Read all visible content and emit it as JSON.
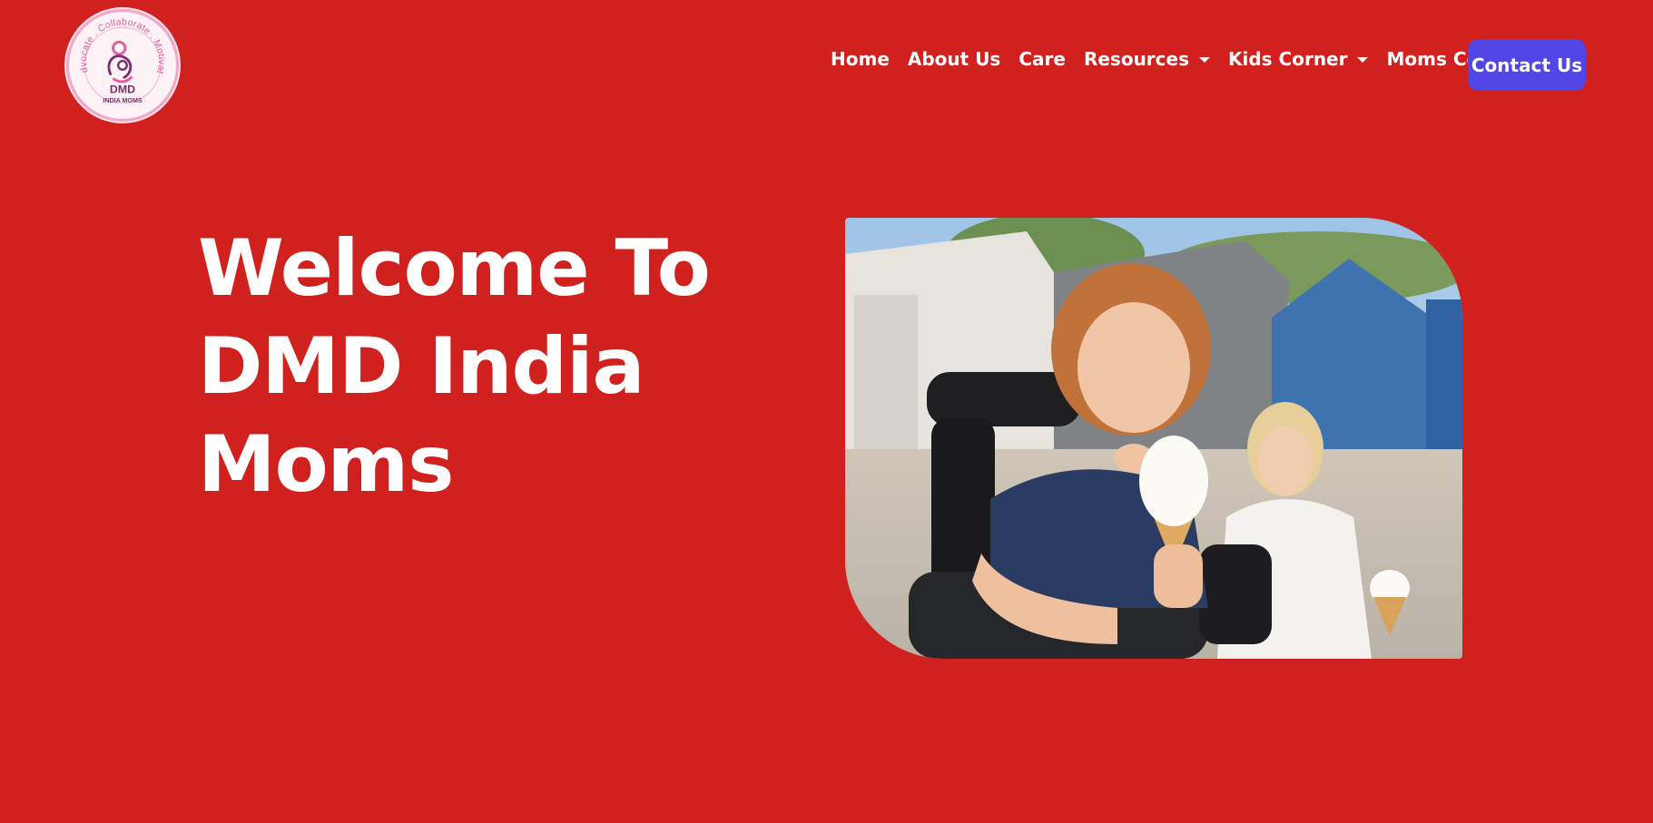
{
  "logo": {
    "arc_text": "Advocate . Collaborate . Motivate",
    "brand": "DMD",
    "sub": "INDIA MOMS"
  },
  "nav": {
    "items": [
      {
        "label": "Home",
        "dropdown": false
      },
      {
        "label": "About Us",
        "dropdown": false
      },
      {
        "label": "Care",
        "dropdown": false
      },
      {
        "label": "Resources",
        "dropdown": true
      },
      {
        "label": "Kids Corner",
        "dropdown": true
      },
      {
        "label": "Moms Corner",
        "dropdown": true
      }
    ],
    "contact_label": "Contact Us"
  },
  "hero": {
    "title_line1": "Welcome To",
    "title_line2": "DMD India",
    "title_line3": "Moms"
  },
  "colors": {
    "background": "#d0211f",
    "accent_button": "#5146e6",
    "text": "#ffffff",
    "logo_pink": "#e65c9a",
    "logo_purple": "#7a2f6e"
  }
}
